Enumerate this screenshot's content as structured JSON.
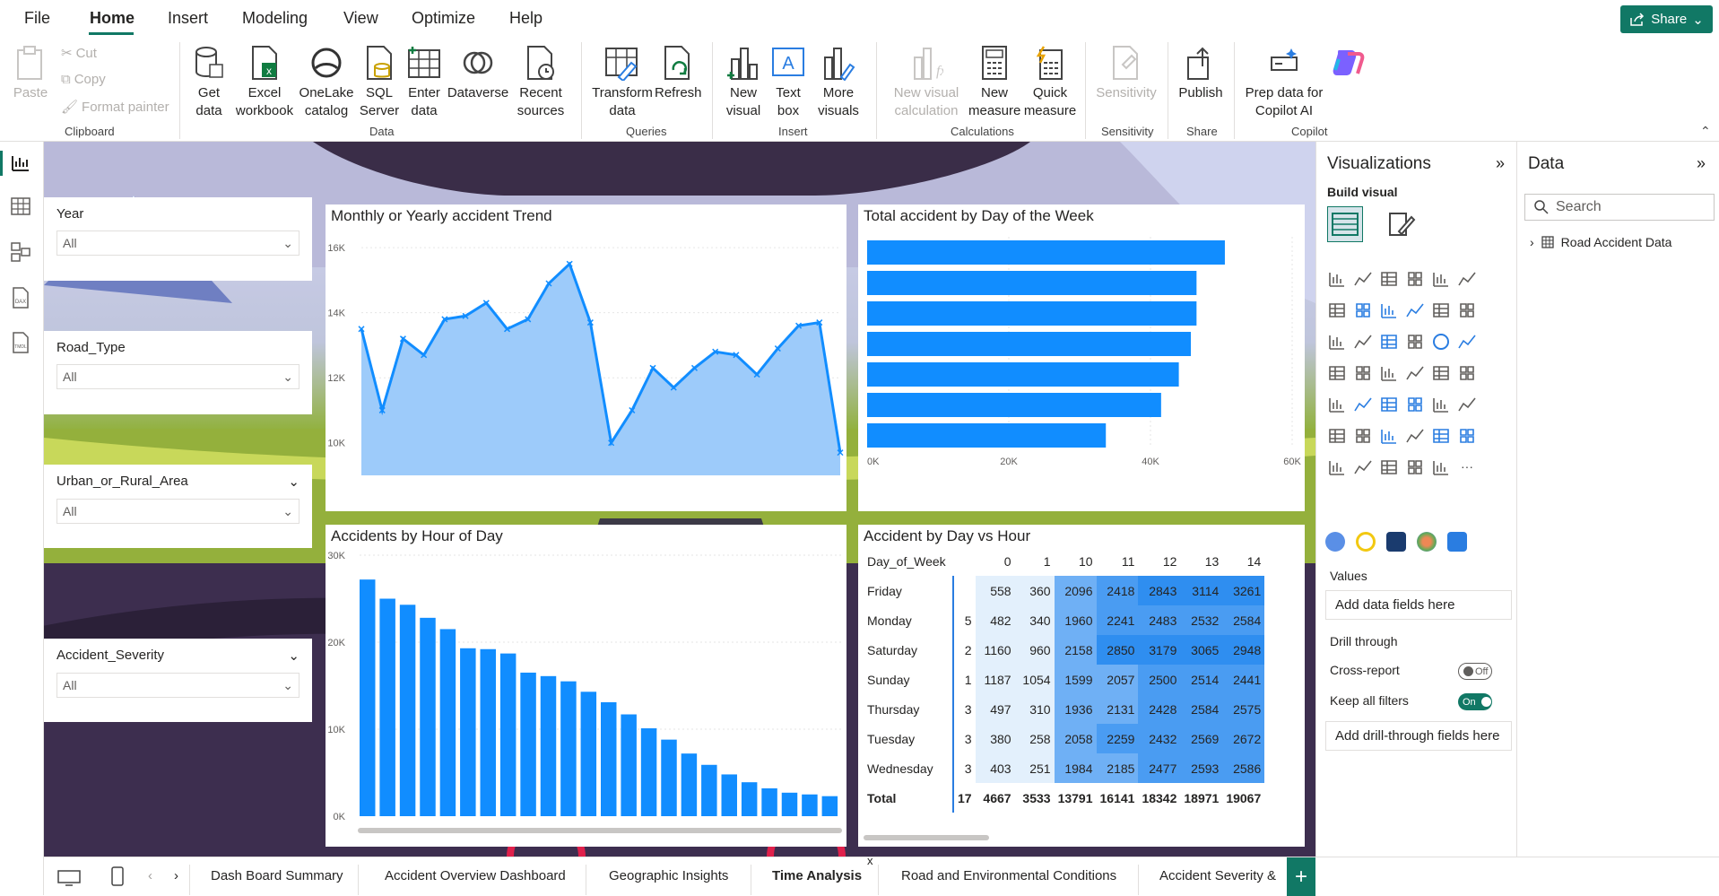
{
  "menu": {
    "file": "File",
    "home": "Home",
    "insert": "Insert",
    "modeling": "Modeling",
    "view": "View",
    "optimize": "Optimize",
    "help": "Help",
    "share": "Share"
  },
  "ribbon": {
    "paste": "Paste",
    "cut": "Cut",
    "copy": "Copy",
    "format_painter": "Format painter",
    "get_data": "Get data",
    "excel": "Excel workbook",
    "onelake": "OneLake catalog",
    "sql": "SQL Server",
    "enter_data": "Enter data",
    "dataverse": "Dataverse",
    "recent": "Recent sources",
    "transform": "Transform data",
    "refresh": "Refresh",
    "new_visual": "New visual",
    "text_box": "Text box",
    "more_visuals": "More visuals",
    "new_visual_calc": "New visual calculation",
    "new_measure": "New measure",
    "quick_measure": "Quick measure",
    "sensitivity": "Sensitivity",
    "publish": "Publish",
    "prep_copilot": "Prep data for Copilot AI",
    "groups": {
      "clipboard": "Clipboard",
      "data": "Data",
      "queries": "Queries",
      "insert": "Insert",
      "calculations": "Calculations",
      "sensitivity": "Sensitivity",
      "share": "Share",
      "copilot": "Copilot"
    }
  },
  "slicers": [
    {
      "label": "Year",
      "value": "All"
    },
    {
      "label": "Road_Type",
      "value": "All"
    },
    {
      "label": "Urban_or_Rural_Area",
      "value": "All"
    },
    {
      "label": "Accident_Severity",
      "value": "All"
    }
  ],
  "visuals": {
    "trend_title": "Monthly or Yearly accident Trend",
    "dow_title": "Total accident by Day of the Week",
    "hour_title": "Accidents by Hour of Day",
    "matrix_title": "Accident by Day vs Hour"
  },
  "chart_data": [
    {
      "type": "area",
      "title": "Monthly or Yearly accident Trend",
      "y_ticks": [
        "16K",
        "14K",
        "12K",
        "10K"
      ],
      "ylim": [
        9000,
        16500
      ],
      "values": [
        13500,
        11000,
        13200,
        12700,
        13800,
        13900,
        14300,
        13500,
        13800,
        14900,
        15500,
        13700,
        10000,
        11000,
        12300,
        11700,
        12300,
        12800,
        12700,
        12100,
        12900,
        13600,
        13700,
        9700
      ]
    },
    {
      "type": "bar",
      "orientation": "horizontal",
      "title": "Total accident by Day of the Week",
      "x_ticks": [
        "0K",
        "20K",
        "40K",
        "60K"
      ],
      "xlim": [
        0,
        60000
      ],
      "values": [
        50500,
        46500,
        46500,
        45700,
        44000,
        41500,
        33700
      ]
    },
    {
      "type": "bar",
      "title": "Accidents by Hour of Day",
      "y_ticks": [
        "30K",
        "20K",
        "10K",
        "0K"
      ],
      "ylim": [
        0,
        30000
      ],
      "values": [
        27200,
        25000,
        24300,
        22800,
        21500,
        19300,
        19200,
        18700,
        16500,
        16100,
        15500,
        14300,
        13100,
        11700,
        10100,
        8800,
        7200,
        5900,
        4800,
        3900,
        3200,
        2700,
        2500,
        2300
      ]
    }
  ],
  "matrix": {
    "header": [
      "Day_of_Week",
      "0",
      "1",
      "10",
      "11",
      "12",
      "13",
      "14"
    ],
    "rows": [
      [
        "Friday",
        "",
        "558",
        "360",
        "2096",
        "2418",
        "2843",
        "3114",
        "3261"
      ],
      [
        "Monday",
        "5",
        "482",
        "340",
        "1960",
        "2241",
        "2483",
        "2532",
        "2584"
      ],
      [
        "Saturday",
        "2",
        "1160",
        "960",
        "2158",
        "2850",
        "3179",
        "3065",
        "2948"
      ],
      [
        "Sunday",
        "1",
        "1187",
        "1054",
        "1599",
        "2057",
        "2500",
        "2514",
        "2441"
      ],
      [
        "Thursday",
        "3",
        "497",
        "310",
        "1936",
        "2131",
        "2428",
        "2584",
        "2575"
      ],
      [
        "Tuesday",
        "3",
        "380",
        "258",
        "2058",
        "2259",
        "2432",
        "2569",
        "2672"
      ],
      [
        "Wednesday",
        "3",
        "403",
        "251",
        "1984",
        "2185",
        "2477",
        "2593",
        "2586"
      ]
    ],
    "total": [
      "Total",
      "17",
      "4667",
      "3533",
      "13791",
      "16141",
      "18342",
      "18971",
      "19067"
    ]
  },
  "viz_pane": {
    "title": "Visualizations",
    "build_visual": "Build visual",
    "values": "Values",
    "add_data": "Add data fields here",
    "drill": "Drill through",
    "cross": "Cross-report",
    "cross_state": "Off",
    "keep": "Keep all filters",
    "keep_state": "On",
    "add_drill": "Add drill-through fields here"
  },
  "data_pane": {
    "title": "Data",
    "search": "Search",
    "table": "Road Accident Data"
  },
  "tabs": [
    "Dash Board Summary",
    "Accident Overview Dashboard",
    "Geographic Insights",
    "Time Analysis",
    "Road and Environmental Conditions",
    "Accident Severity &"
  ],
  "colors": {
    "accent": "#117865",
    "bar": "#118DFF",
    "area": "#9DCBFA"
  }
}
